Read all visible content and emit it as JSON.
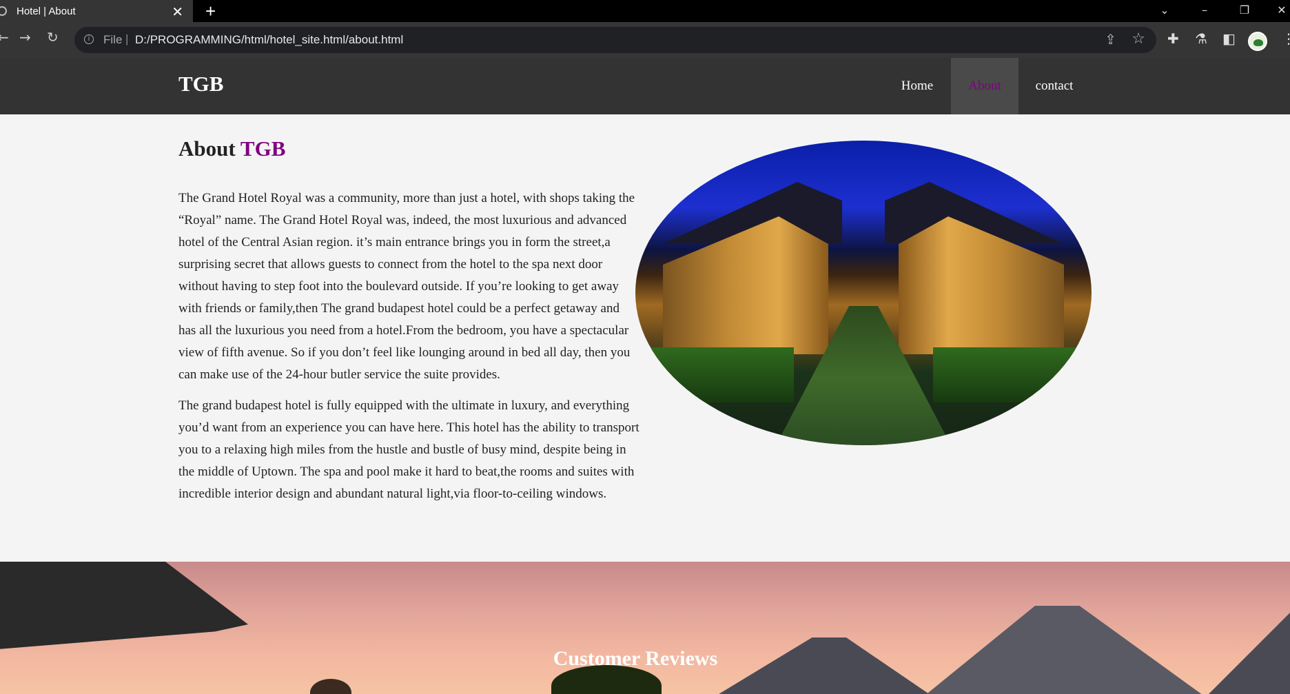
{
  "browser": {
    "tab_title": "Hotel | About",
    "tab_close": "✕",
    "new_tab": "+",
    "address": {
      "scheme": "File",
      "separator": "|",
      "url": "D:/PROGRAMMING/html/hotel_site.html/about.html"
    }
  },
  "site": {
    "logo": "TGB",
    "nav": [
      {
        "label": "Home",
        "active": false
      },
      {
        "label": "About",
        "active": true
      },
      {
        "label": "contact",
        "active": false
      }
    ]
  },
  "about": {
    "heading_prefix": "About",
    "heading_brand": "TGB",
    "paragraphs": [
      "The Grand Hotel Royal was a community, more than just a hotel, with shops taking the “Royal” name. The Grand Hotel Royal was, indeed, the most luxurious and advanced hotel of the Central Asian region. it’s main entrance brings you in form the street,a surprising secret that allows guests to connect from the hotel to the spa next door without having to step foot into the boulevard outside. If you’re looking to get away with friends or family,then The grand budapest hotel could be a perfect getaway and has all the luxurious you need from a hotel.From the bedroom, you have a spectacular view of fifth avenue. So if you don’t feel like lounging around in bed all day, then you can make use of the 24-hour butler service the suite provides.",
      "The grand budapest hotel is fully equipped with the ultimate in luxury, and everything you’d want from an experience you can have here. This hotel has the ability to transport you to a relaxing high miles from the hustle and bustle of busy mind, despite being in the middle of Uptown. The spa and pool make it hard to beat,the rooms and suites with incredible interior design and abundant natural light,via floor-to-ceiling windows."
    ]
  },
  "reviews": {
    "title": "Customer Reviews"
  },
  "colors": {
    "brand": "#800080",
    "nav_bg": "#333333",
    "page_bg": "#f4f4f4"
  }
}
